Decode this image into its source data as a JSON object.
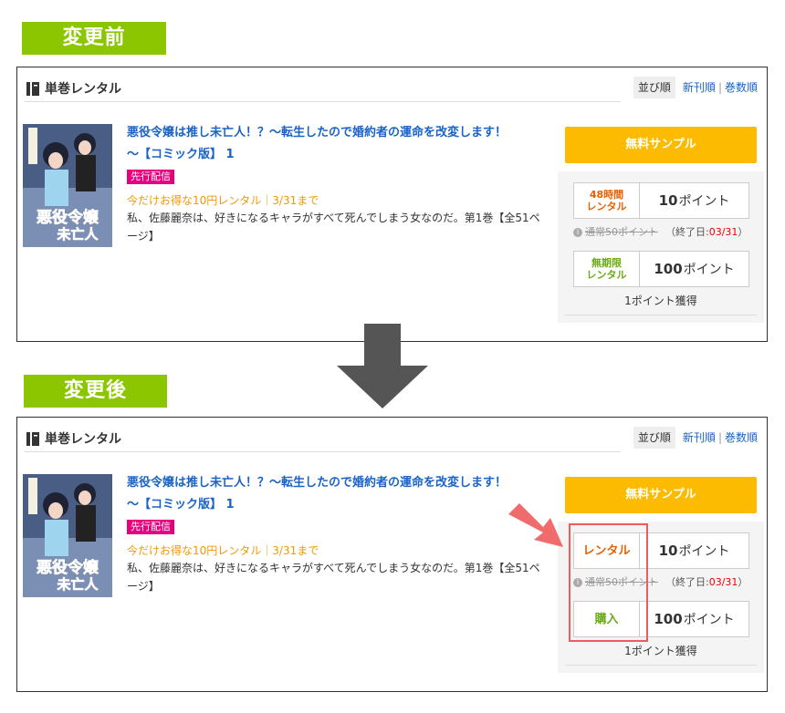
{
  "labels": {
    "before": "変更前",
    "after": "変更後"
  },
  "panel": {
    "title": "単巻レンタル",
    "sort": {
      "active": "並び順",
      "new": "新刊順",
      "sep": "|",
      "volume": "巻数順"
    }
  },
  "book": {
    "title_line1": "悪役令嬢は推し未亡人！？～転生したので婚約者の運命を改変します！",
    "title_line2": "～【コミック版】 1",
    "badge": "先行配信",
    "promo": "今だけお得な10円レンタル｜3/31まで",
    "desc_line1": "私、佐藤麗奈は、好きになるキャラがすべて死んでしまう女なのだ。第1巻【全51ペ",
    "desc_line2": "ージ】",
    "cover_text": "悪役令嬢は推し未亡人"
  },
  "side": {
    "free_sample": "無料サンプル",
    "note_strike": "通常50ポイント",
    "note_end_prefix": "（終了日:",
    "note_end_date": "03/31",
    "note_end_suffix": "）",
    "points_earned": "1ポイント獲得"
  },
  "before": {
    "rental": {
      "type_line1": "48時間",
      "type_line2": "レンタル",
      "points": "10",
      "unit": "ポイント"
    },
    "purchase": {
      "type_line1": "無期限",
      "type_line2": "レンタル",
      "points": "100",
      "unit": "ポイント"
    }
  },
  "after": {
    "rental": {
      "type": "レンタル",
      "points": "10",
      "unit": "ポイント"
    },
    "purchase": {
      "type": "購入",
      "points": "100",
      "unit": "ポイント"
    }
  },
  "colors": {
    "green_label": "#8bc600",
    "link": "#1a63c6",
    "free_button": "#fcbb00",
    "rental_orange": "#ea6000",
    "purchase_green": "#6aab16",
    "highlight_red": "#f05b5b"
  }
}
